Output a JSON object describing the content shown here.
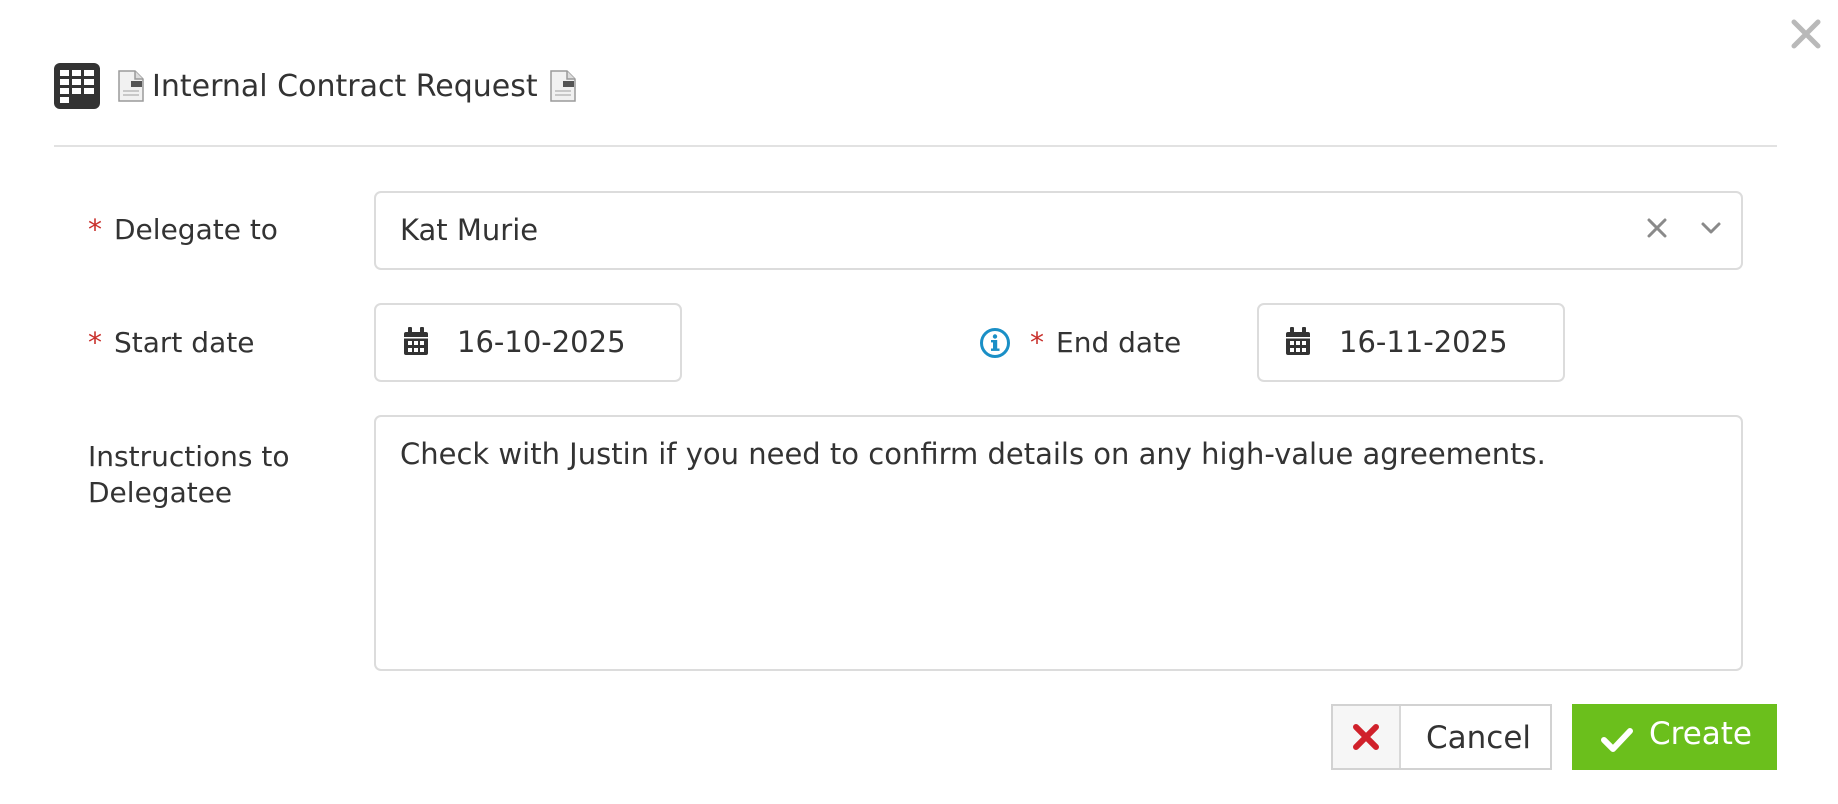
{
  "dialog": {
    "title": "Internal Contract Request",
    "close_icon": "close-icon"
  },
  "form": {
    "required_marker": "*",
    "delegate": {
      "label": "Delegate to",
      "value": "Kat Murie"
    },
    "start_date": {
      "label": "Start date",
      "value": "16-10-2025"
    },
    "end_date": {
      "label": "End date",
      "value": "16-11-2025"
    },
    "instructions": {
      "label_line1": "Instructions to",
      "label_line2": "Delegatee",
      "value": "Check with Justin if you need to confirm details on any high-value agreements."
    }
  },
  "actions": {
    "cancel_label": "Cancel",
    "create_label": "Create"
  },
  "colors": {
    "required": "#c9302c",
    "info": "#1a8fc6",
    "create_button": "#6bbf1c",
    "cancel_icon": "#d0212b"
  }
}
